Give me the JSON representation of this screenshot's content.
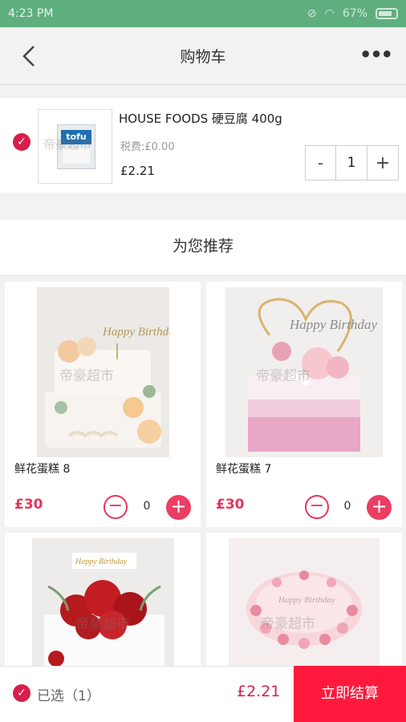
{
  "status_bar": {
    "time": "4:23 PM",
    "battery": "67%"
  },
  "nav": {
    "title": "购物车",
    "more": "•••"
  },
  "cart": {
    "item": {
      "name": "HOUSE FOODS 硬豆腐 400g",
      "tax": "税费:£0.00",
      "price": "£2.21",
      "quantity": "1",
      "pack_text": "tofu"
    },
    "stepper": {
      "minus": "-",
      "plus": "+"
    }
  },
  "watermark": "帝豪超市",
  "recommend": {
    "title": "为您推荐",
    "items": [
      {
        "name": "鲜花蛋糕 8",
        "price": "£30",
        "quantity": "0",
        "cake_text": "Happy Birthday"
      },
      {
        "name": "鲜花蛋糕 7",
        "price": "£30",
        "quantity": "0",
        "cake_text": "Happy Birthday"
      },
      {
        "name": "",
        "price": "",
        "quantity": "",
        "cake_text": "Happy Birthday"
      },
      {
        "name": "",
        "price": "",
        "quantity": "",
        "cake_text": "Happy Birthday"
      }
    ]
  },
  "bottom": {
    "selected": "已选（1）",
    "total": "£2.21",
    "checkout": "立即结算"
  },
  "colors": {
    "accent": "#e8345e",
    "status_bar": "#5fae7e",
    "checkout": "#ff1a3d"
  }
}
